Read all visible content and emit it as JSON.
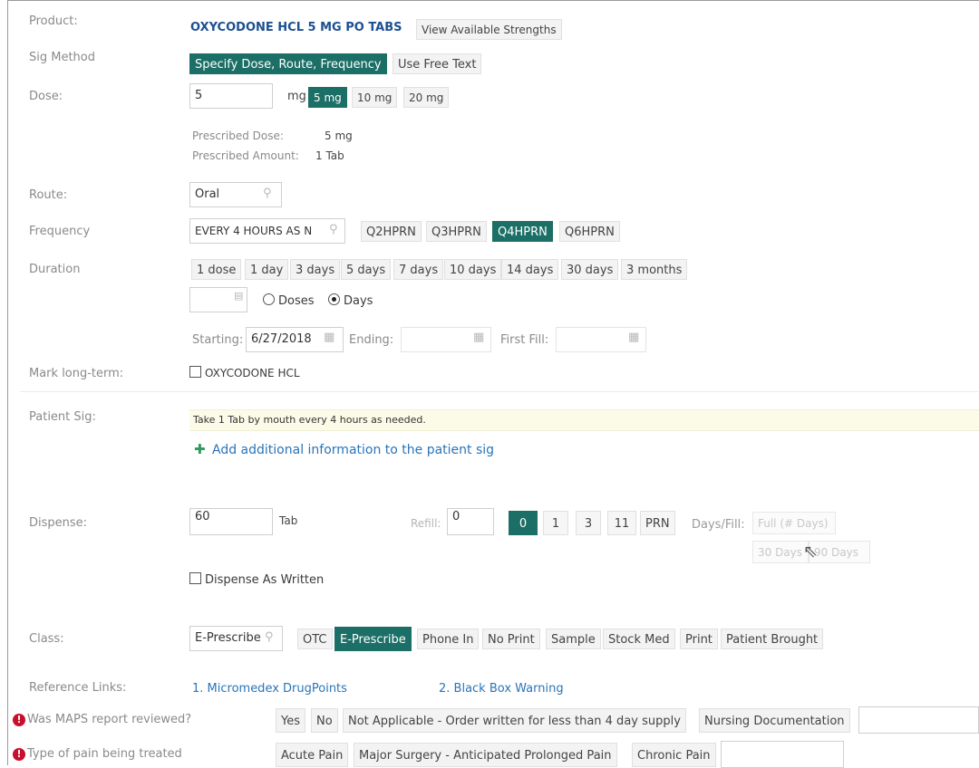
{
  "product": {
    "label": "Product:",
    "name": "OXYCODONE HCL 5 MG PO TABS",
    "strengths_button": "View Available Strengths"
  },
  "sig_method": {
    "label": "Sig Method",
    "options": [
      "Specify Dose, Route, Frequency",
      "Use Free Text"
    ],
    "selected": 0
  },
  "dose": {
    "label": "Dose:",
    "value": "5",
    "unit": "mg",
    "options": [
      "5 mg",
      "10 mg",
      "20 mg"
    ],
    "selected": 0,
    "prescribed_dose_label": "Prescribed Dose:",
    "prescribed_dose_value": "5 mg",
    "prescribed_amount_label": "Prescribed Amount:",
    "prescribed_amount_value": "1 Tab"
  },
  "route": {
    "label": "Route:",
    "value": "Oral"
  },
  "frequency": {
    "label": "Frequency",
    "value": "EVERY 4 HOURS AS N",
    "options": [
      "Q2HPRN",
      "Q3HPRN",
      "Q4HPRN",
      "Q6HPRN"
    ],
    "selected": 2
  },
  "duration": {
    "label": "Duration",
    "options": [
      "1 dose",
      "1 day",
      "3 days",
      "5 days",
      "7 days",
      "10 days",
      "14 days",
      "30 days",
      "3 months"
    ],
    "value": "",
    "doses_label": "Doses",
    "days_label": "Days",
    "selected_unit": "Days",
    "starting_label": "Starting:",
    "starting_value": "6/27/2018",
    "ending_label": "Ending:",
    "ending_value": "",
    "first_fill_label": "First Fill:",
    "first_fill_value": ""
  },
  "long_term": {
    "label": "Mark long-term:",
    "checkbox_label": "OXYCODONE HCL",
    "checked": false
  },
  "patient_sig": {
    "label": "Patient Sig:",
    "text": "Take 1 Tab by mouth every 4 hours as needed.",
    "add_info_link": "Add additional information to the patient sig"
  },
  "dispense": {
    "label": "Dispense:",
    "value": "60",
    "unit": "Tab",
    "refill_label": "Refill:",
    "refill_value": "0",
    "refill_options": [
      "0",
      "1",
      "3",
      "11",
      "PRN"
    ],
    "refill_selected": 0,
    "days_fill_label": "Days/Fill:",
    "days_fill_options": [
      "Full (# Days)",
      "30 Days",
      "90 Days"
    ],
    "daw_label": "Dispense As Written",
    "daw_checked": false
  },
  "class": {
    "label": "Class:",
    "value": "E-Prescribe",
    "options": [
      "OTC",
      "E-Prescribe",
      "Phone In",
      "No Print",
      "Sample",
      "Stock Med",
      "Print",
      "Patient Brought"
    ],
    "selected": 1
  },
  "reference_links": {
    "label": "Reference Links:",
    "links": [
      "1. Micromedex DrugPoints",
      "2. Black Box Warning"
    ]
  },
  "maps_report": {
    "label": "Was MAPS report reviewed?",
    "options": [
      "Yes",
      "No",
      "Not Applicable - Order written for less than 4 day supply",
      "Nursing Documentation"
    ]
  },
  "pain_type": {
    "label": "Type of pain being treated",
    "options": [
      "Acute Pain",
      "Major Surgery - Anticipated Prolonged Pain",
      "Chronic Pain"
    ]
  },
  "colors": {
    "accent": "#1c6f66",
    "link": "#2a74b8",
    "warning": "#c8102e",
    "label": "#8a8a8a"
  },
  "icons": {
    "search": "search-icon",
    "calendar": "calendar-icon",
    "plus": "plus-icon",
    "warning": "warning-icon"
  }
}
